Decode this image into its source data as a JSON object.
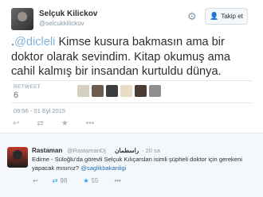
{
  "header": {
    "name": "Selçuk Kilickov",
    "handle": "@selcukkilickov",
    "follow_label": "Takip et",
    "follow_icon": "person-add-icon",
    "settings_icon": "gear-icon"
  },
  "tweet": {
    "mention": "@dicleli",
    "text_before": ".",
    "text_after": " Kimse kusura bakmasın ama bir doktor olarak sevindim. Kitap okumuş ama cahil kalmış bir insandan kurtuldu dünya."
  },
  "stats": {
    "retweets_label": "RETWEET",
    "retweets_count": "6",
    "retweeter_colors": [
      "#d6cfc4",
      "#6d5c4e",
      "#3d3d3d",
      "#e8dcc6",
      "#4a3b33",
      "#8f8f8f"
    ]
  },
  "meta": {
    "timestamp": "09:56 - 01 Eyl 2015"
  },
  "actions": {
    "reply_icon": "reply-icon",
    "retweet_icon": "retweet-icon",
    "favorite_icon": "star-icon",
    "more_icon": "more-icon"
  },
  "reply": {
    "name": "Rastaman",
    "handle": "@RastamanDj",
    "arabic_name": "راسطمان",
    "time": "· 20 sa",
    "text_main": "Edirne - Süloğlu'da görevli Selçuk Kılıçarslan isimli şüpheli doktor için gerekeni yapacak mısınız? ",
    "text_mention": "@saglikbakanligi",
    "retweets": "98",
    "favorites": "55",
    "accent_color": "#1da1f2"
  }
}
